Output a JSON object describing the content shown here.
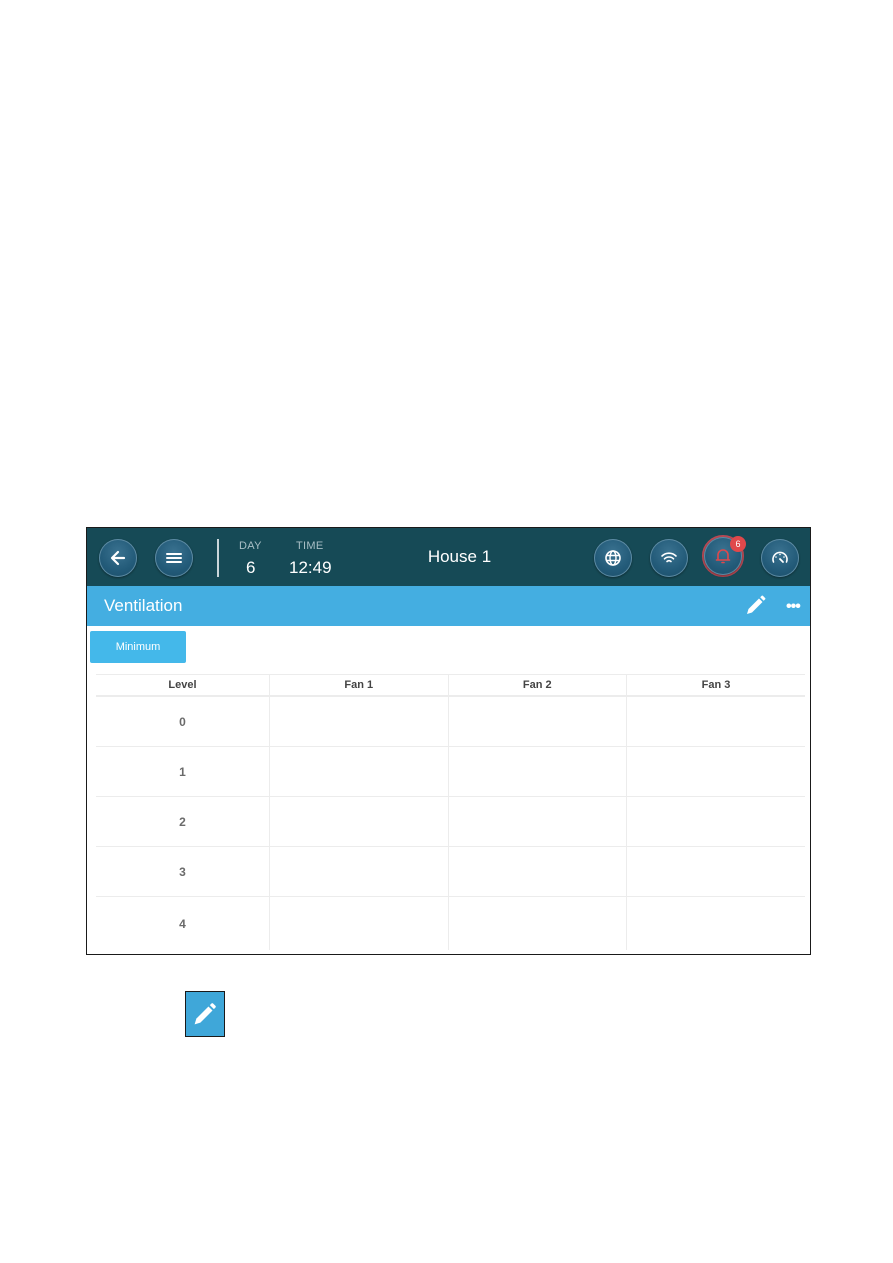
{
  "header": {
    "day_label": "DAY",
    "day_value": "6",
    "time_label": "TIME",
    "time_value": "12:49",
    "house_name": "House 1",
    "alarm_count": "6",
    "buttons": {
      "back": "back-arrow-icon",
      "menu": "hamburger-menu-icon",
      "globe": "globe-icon",
      "wifi": "wifi-icon",
      "alarm": "bell-icon",
      "dashboard": "gauge-icon"
    }
  },
  "titlebar": {
    "title": "Ventilation",
    "edit_icon": "pencil-icon",
    "more_icon": "ellipsis-icon",
    "more_label": "•••"
  },
  "tabs": [
    {
      "label": "Minimum",
      "active": true
    }
  ],
  "table": {
    "columns": [
      "Level",
      "Fan 1",
      "Fan 2",
      "Fan 3"
    ],
    "rows": [
      {
        "level": "0",
        "fan1": "",
        "fan2": "",
        "fan3": ""
      },
      {
        "level": "1",
        "fan1": "",
        "fan2": "",
        "fan3": ""
      },
      {
        "level": "2",
        "fan1": "",
        "fan2": "",
        "fan3": ""
      },
      {
        "level": "3",
        "fan1": "",
        "fan2": "",
        "fan3": ""
      },
      {
        "level": "4",
        "fan1": "",
        "fan2": "",
        "fan3": ""
      }
    ]
  },
  "document_icon": "pencil-icon",
  "colors": {
    "topbar": "#164a56",
    "titlebar": "#44aee1",
    "tab_active": "#44b8ea",
    "alarm_ring": "#b94a55",
    "badge": "#e0484b"
  }
}
